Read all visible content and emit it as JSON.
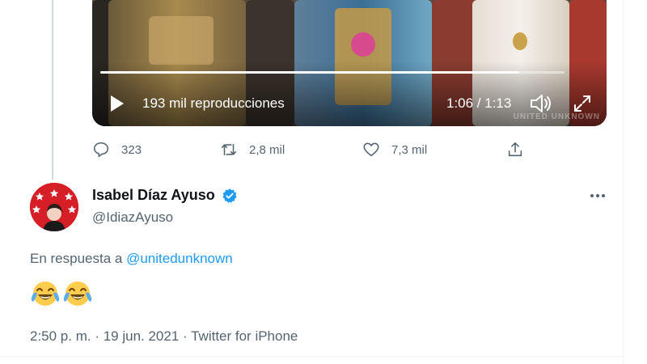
{
  "video": {
    "views_label": "193 mil reproducciones",
    "time_label": "1:06 / 1:13",
    "progress": 0.903,
    "watermark": "UNITED UNKNOWN"
  },
  "actions": {
    "reply_count": "323",
    "retweet_count": "2,8 mil",
    "like_count": "7,3 mil"
  },
  "tweet": {
    "author_name": "Isabel Díaz Ayuso",
    "handle": "@IdiazAyuso",
    "reply_prefix": "En respuesta a",
    "reply_mention": "@unitedunknown",
    "emoji_text": "😂😂",
    "timestamp": "2:50 p. m. · 19 jun. 2021 ·",
    "source": "Twitter for iPhone"
  },
  "colors": {
    "accent": "#1d9bf0",
    "secondary_text": "#536471",
    "avatar_bg": "#d61e27"
  }
}
